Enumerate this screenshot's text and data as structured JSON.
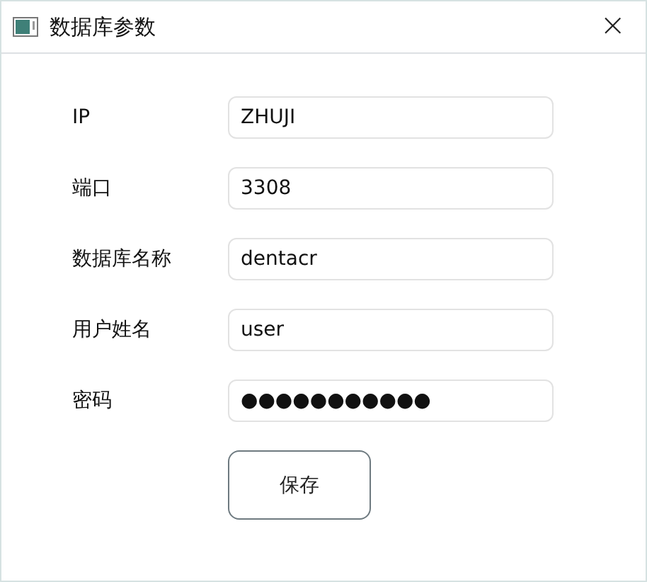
{
  "window": {
    "title": "数据库参数",
    "close": "×"
  },
  "fields": [
    {
      "label": "IP",
      "value": "ZHUJI"
    },
    {
      "label": "端口",
      "value": "3308"
    },
    {
      "label": "数据库名称",
      "value": "dentacr"
    },
    {
      "label": "用户姓名",
      "value": "user"
    },
    {
      "label": "密码",
      "value": "●●●●●●●●●●●"
    }
  ],
  "buttons": [
    "保存"
  ]
}
